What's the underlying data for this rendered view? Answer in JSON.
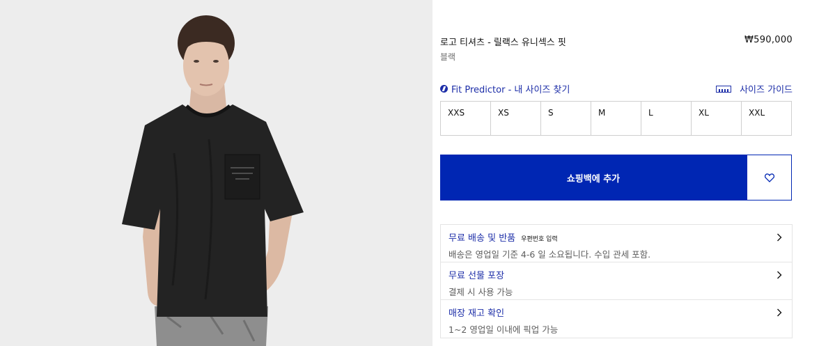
{
  "product": {
    "title": "로고 티셔츠 - 릴랙스 유니섹스 핏",
    "price": "₩590,000",
    "color": "블랙"
  },
  "fit_predictor": {
    "label": "Fit Predictor - 내 사이즈 찾기",
    "icon": "fit-predictor-icon"
  },
  "size_guide": {
    "label": "사이즈 가이드",
    "icon": "ruler-icon"
  },
  "sizes": [
    "XXS",
    "XS",
    "S",
    "M",
    "L",
    "XL",
    "XXL"
  ],
  "cart": {
    "add_label": "쇼핑백에 추가",
    "wishlist_icon": "heart-icon"
  },
  "info": [
    {
      "title": "무료 배송 및 반품",
      "badge": "우편번호 입력",
      "subtitle": "배송은 영업일 기준 4-6 일 소요됩니다. 수입 관세 포함."
    },
    {
      "title": "무료 선물 포장",
      "badge": "",
      "subtitle": "결제 시 사용 가능"
    },
    {
      "title": "매장 재고 확인",
      "badge": "",
      "subtitle": "1~2 영업일 이내에 픽업 가능"
    }
  ],
  "colors": {
    "accent": "#1d2ea8",
    "button": "#0026b3",
    "image_bg": "#ededed"
  }
}
